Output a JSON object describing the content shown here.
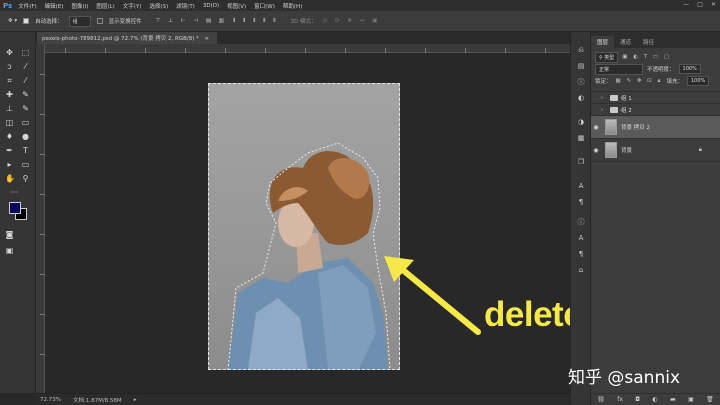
{
  "app": {
    "logo": "Ps"
  },
  "menu": [
    "文件(F)",
    "编辑(E)",
    "图像(I)",
    "图层(L)",
    "文字(Y)",
    "选择(S)",
    "滤镜(T)",
    "3D(D)",
    "视图(V)",
    "窗口(W)",
    "帮助(H)"
  ],
  "window_controls": [
    "—",
    "□",
    "✕"
  ],
  "options": {
    "auto_select_label": "自动选择：",
    "auto_select_value": "组",
    "show_transform_label": "显示变换控件",
    "mode_3d_label": "3D 模式："
  },
  "document": {
    "tab_title": "pexels-photo-789812.psd @ 72.7% (背景 拷贝 2, RGB/8) *",
    "tab_close": "×"
  },
  "status": {
    "zoom": "72.73%",
    "doc_size": "文档:1.87M/8.58M"
  },
  "layers_panel": {
    "tabs": [
      "图层",
      "通道",
      "路径"
    ],
    "filter_kind": "类型",
    "blend_mode": "正常",
    "opacity_label": "不透明度：",
    "opacity_value": "100%",
    "lock_label": "锁定：",
    "fill_label": "填充：",
    "fill_value": "100%",
    "layers": [
      {
        "name": "组 1",
        "type": "group",
        "visible": false
      },
      {
        "name": "组 2",
        "type": "group",
        "visible": false
      },
      {
        "name": "背景 拷贝 2",
        "type": "layer",
        "visible": true,
        "selected": true
      },
      {
        "name": "背景",
        "type": "layer",
        "visible": true,
        "locked": true
      }
    ]
  },
  "annotation": {
    "text": "delete",
    "color": "#f7e84a"
  },
  "watermark": "知乎 @sannix",
  "colors": {
    "foreground": "#0a0a5a",
    "background": "#000000",
    "accent_ps": "#31a8ff"
  }
}
